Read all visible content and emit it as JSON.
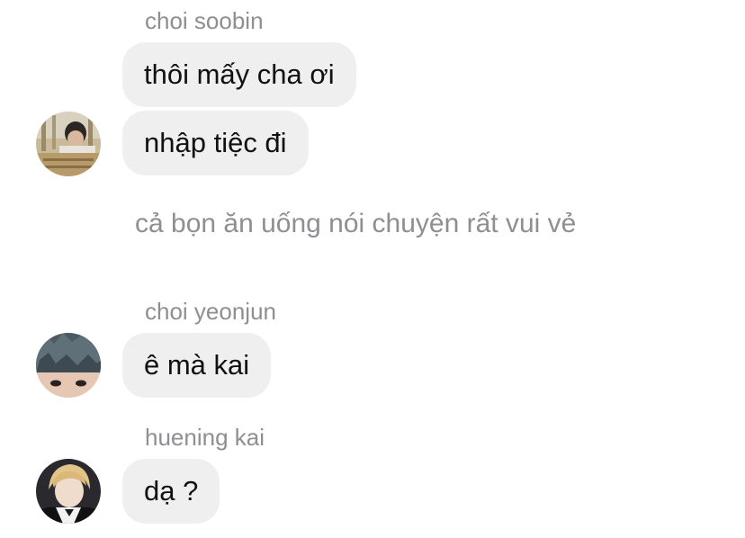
{
  "thread": {
    "group1": {
      "sender": "choi soobin",
      "messages": [
        "thôi mấy cha ơi",
        "nhập tiệc đi"
      ],
      "avatar_icon": "user-avatar-soobin"
    },
    "narration": "cả bọn ăn uống nói chuyện rất vui vẻ",
    "group2": {
      "sender": "choi yeonjun",
      "messages": [
        "ê mà kai"
      ],
      "avatar_icon": "user-avatar-yeonjun"
    },
    "group3": {
      "sender": "huening kai",
      "messages": [
        "dạ ?"
      ],
      "avatar_icon": "user-avatar-kai"
    }
  },
  "colors": {
    "bubble_background": "#efefef",
    "sender_text": "#8e8e93",
    "message_text": "#111111",
    "page_background": "#ffffff"
  }
}
